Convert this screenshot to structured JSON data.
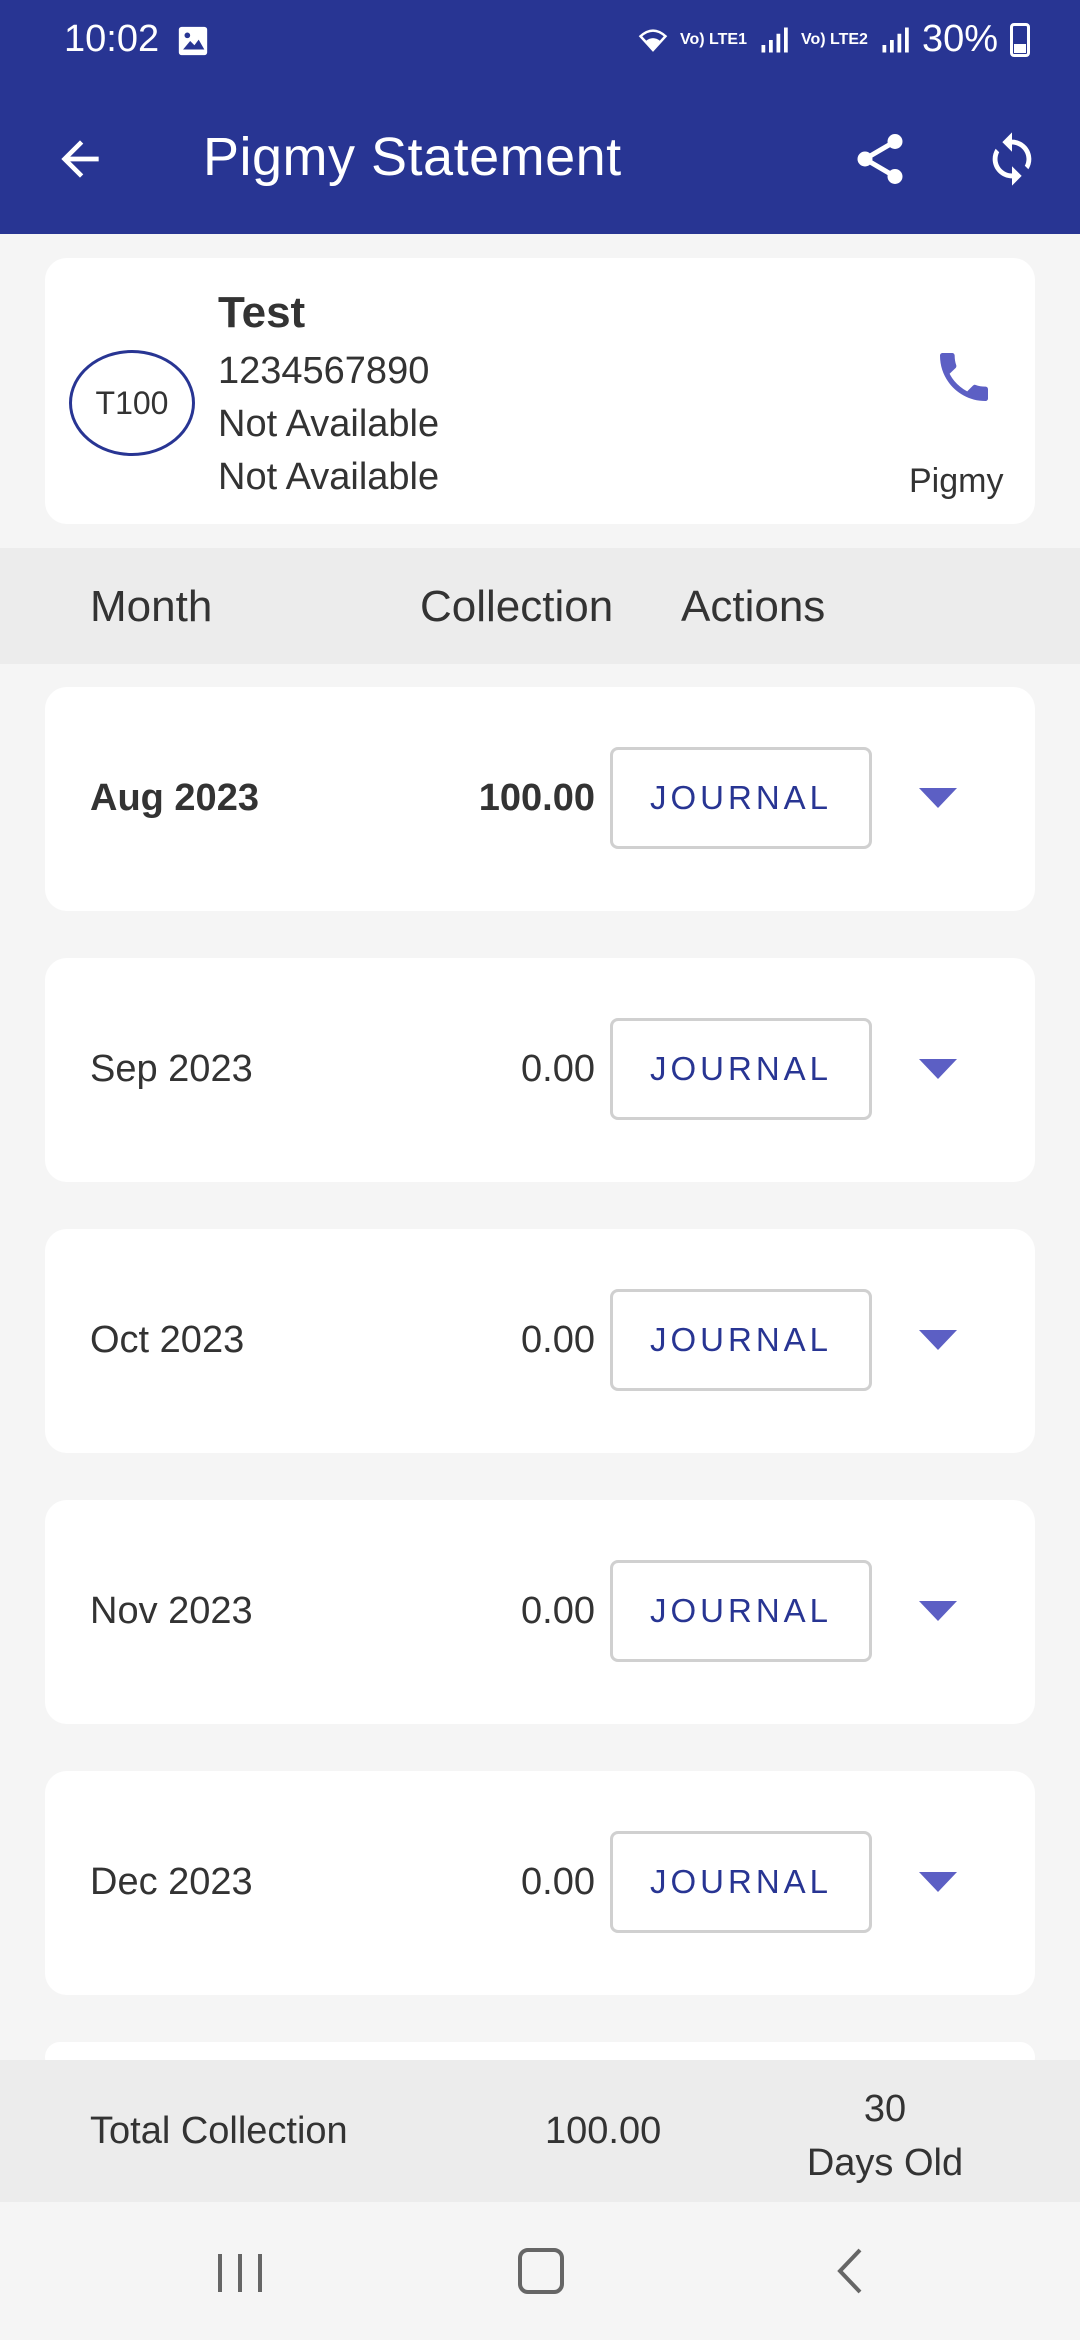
{
  "status_bar": {
    "time": "10:02",
    "battery": "30%",
    "sim1": "Vo) LTE1",
    "sim2": "Vo) LTE2"
  },
  "app_bar": {
    "title": "Pigmy Statement"
  },
  "profile": {
    "initials": "T100",
    "name": "Test",
    "phone": "1234567890",
    "line2": "Not Available",
    "line3": "Not Available",
    "call_label": "Pigmy"
  },
  "table": {
    "headers": {
      "month": "Month",
      "collection": "Collection",
      "actions": "Actions"
    },
    "journal_label": "JOURNAL",
    "rows": [
      {
        "month": "Aug 2023",
        "amount": "100.00"
      },
      {
        "month": "Sep 2023",
        "amount": "0.00"
      },
      {
        "month": "Oct 2023",
        "amount": "0.00"
      },
      {
        "month": "Nov 2023",
        "amount": "0.00"
      },
      {
        "month": "Dec 2023",
        "amount": "0.00"
      }
    ]
  },
  "footer": {
    "label": "Total Collection",
    "total": "100.00",
    "days_value": "30",
    "days_label": "Days Old"
  },
  "colors": {
    "primary": "#283593",
    "accent": "#5c5fc4",
    "background": "#f5f5f5"
  }
}
